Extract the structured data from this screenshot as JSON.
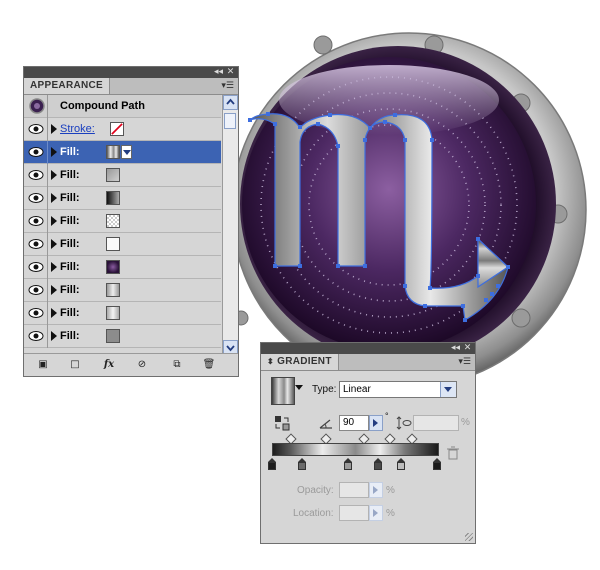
{
  "appearance_panel": {
    "tab_title": "APPEARANCE",
    "menu_icon": "panel-menu-icon",
    "window_controls": [
      "collapse-icon",
      "close-icon"
    ],
    "header": {
      "label": "Compound Path",
      "icon": "compound-path-thumbnail"
    },
    "rows": [
      {
        "label": "Stroke:",
        "kind": "stroke",
        "swatch": "none",
        "selected": false
      },
      {
        "label": "Fill:",
        "kind": "fill",
        "swatch": "silver-gradient",
        "selected": true
      },
      {
        "label": "Fill:",
        "kind": "fill",
        "swatch": "gray-gradient",
        "selected": false
      },
      {
        "label": "Fill:",
        "kind": "fill",
        "swatch": "dark-gradient",
        "selected": false
      },
      {
        "label": "Fill:",
        "kind": "fill",
        "swatch": "checker-pattern",
        "selected": false
      },
      {
        "label": "Fill:",
        "kind": "fill",
        "swatch": "white",
        "selected": false
      },
      {
        "label": "Fill:",
        "kind": "fill",
        "swatch": "purple-radial",
        "selected": false
      },
      {
        "label": "Fill:",
        "kind": "fill",
        "swatch": "light-gradient",
        "selected": false
      },
      {
        "label": "Fill:",
        "kind": "fill",
        "swatch": "light-gradient-2",
        "selected": false
      },
      {
        "label": "Fill:",
        "kind": "fill",
        "swatch": "gray",
        "selected": false
      }
    ],
    "footer_icons": [
      "new-art-basic-icon",
      "add-stroke-icon",
      "fx-icon",
      "clear-appearance-icon",
      "duplicate-item-icon",
      "delete-icon"
    ],
    "footer_fx_label": "fx"
  },
  "gradient_panel": {
    "tab_title": "GRADIENT",
    "type_label": "Type:",
    "type_value": "Linear",
    "angle_value": "90",
    "angle_unit": "°",
    "aspect_unit": "%",
    "opacity_label": "Opacity:",
    "opacity_unit": "%",
    "location_label": "Location:",
    "location_unit": "%",
    "stops": [
      {
        "position": 0.0,
        "color": "#1e1e1e"
      },
      {
        "position": 0.18,
        "color": "#6a6a6a"
      },
      {
        "position": 0.46,
        "color": "#9a9a9a"
      },
      {
        "position": 0.64,
        "color": "#4a4a4a"
      },
      {
        "position": 0.78,
        "color": "#bdbdbd"
      },
      {
        "position": 1.0,
        "color": "#1a1a1a"
      }
    ],
    "midpoints": [
      0.11,
      0.32,
      0.55,
      0.71,
      0.84
    ]
  },
  "colors": {
    "selection": "#3c63b3",
    "path_handles": "#3d6ee0",
    "dark_purple": "#2a1238",
    "rim": "#b5b5b5"
  }
}
